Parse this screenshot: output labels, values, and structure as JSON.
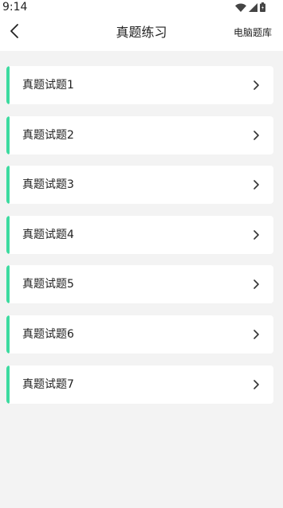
{
  "status_bar": {
    "time": "9:14",
    "icons": [
      "wifi-icon",
      "cellular-signal-icon",
      "battery-icon"
    ]
  },
  "header": {
    "back_icon": "chevron-left-icon",
    "title": "真题练习",
    "action_label": "电脑题库"
  },
  "theme": {
    "accent": "#3ddba0",
    "background": "#f3f3f3",
    "card": "#ffffff"
  },
  "items": [
    {
      "label": "真题试题1"
    },
    {
      "label": "真题试题2"
    },
    {
      "label": "真题试题3"
    },
    {
      "label": "真题试题4"
    },
    {
      "label": "真题试题5"
    },
    {
      "label": "真题试题6"
    },
    {
      "label": "真题试题7"
    }
  ]
}
